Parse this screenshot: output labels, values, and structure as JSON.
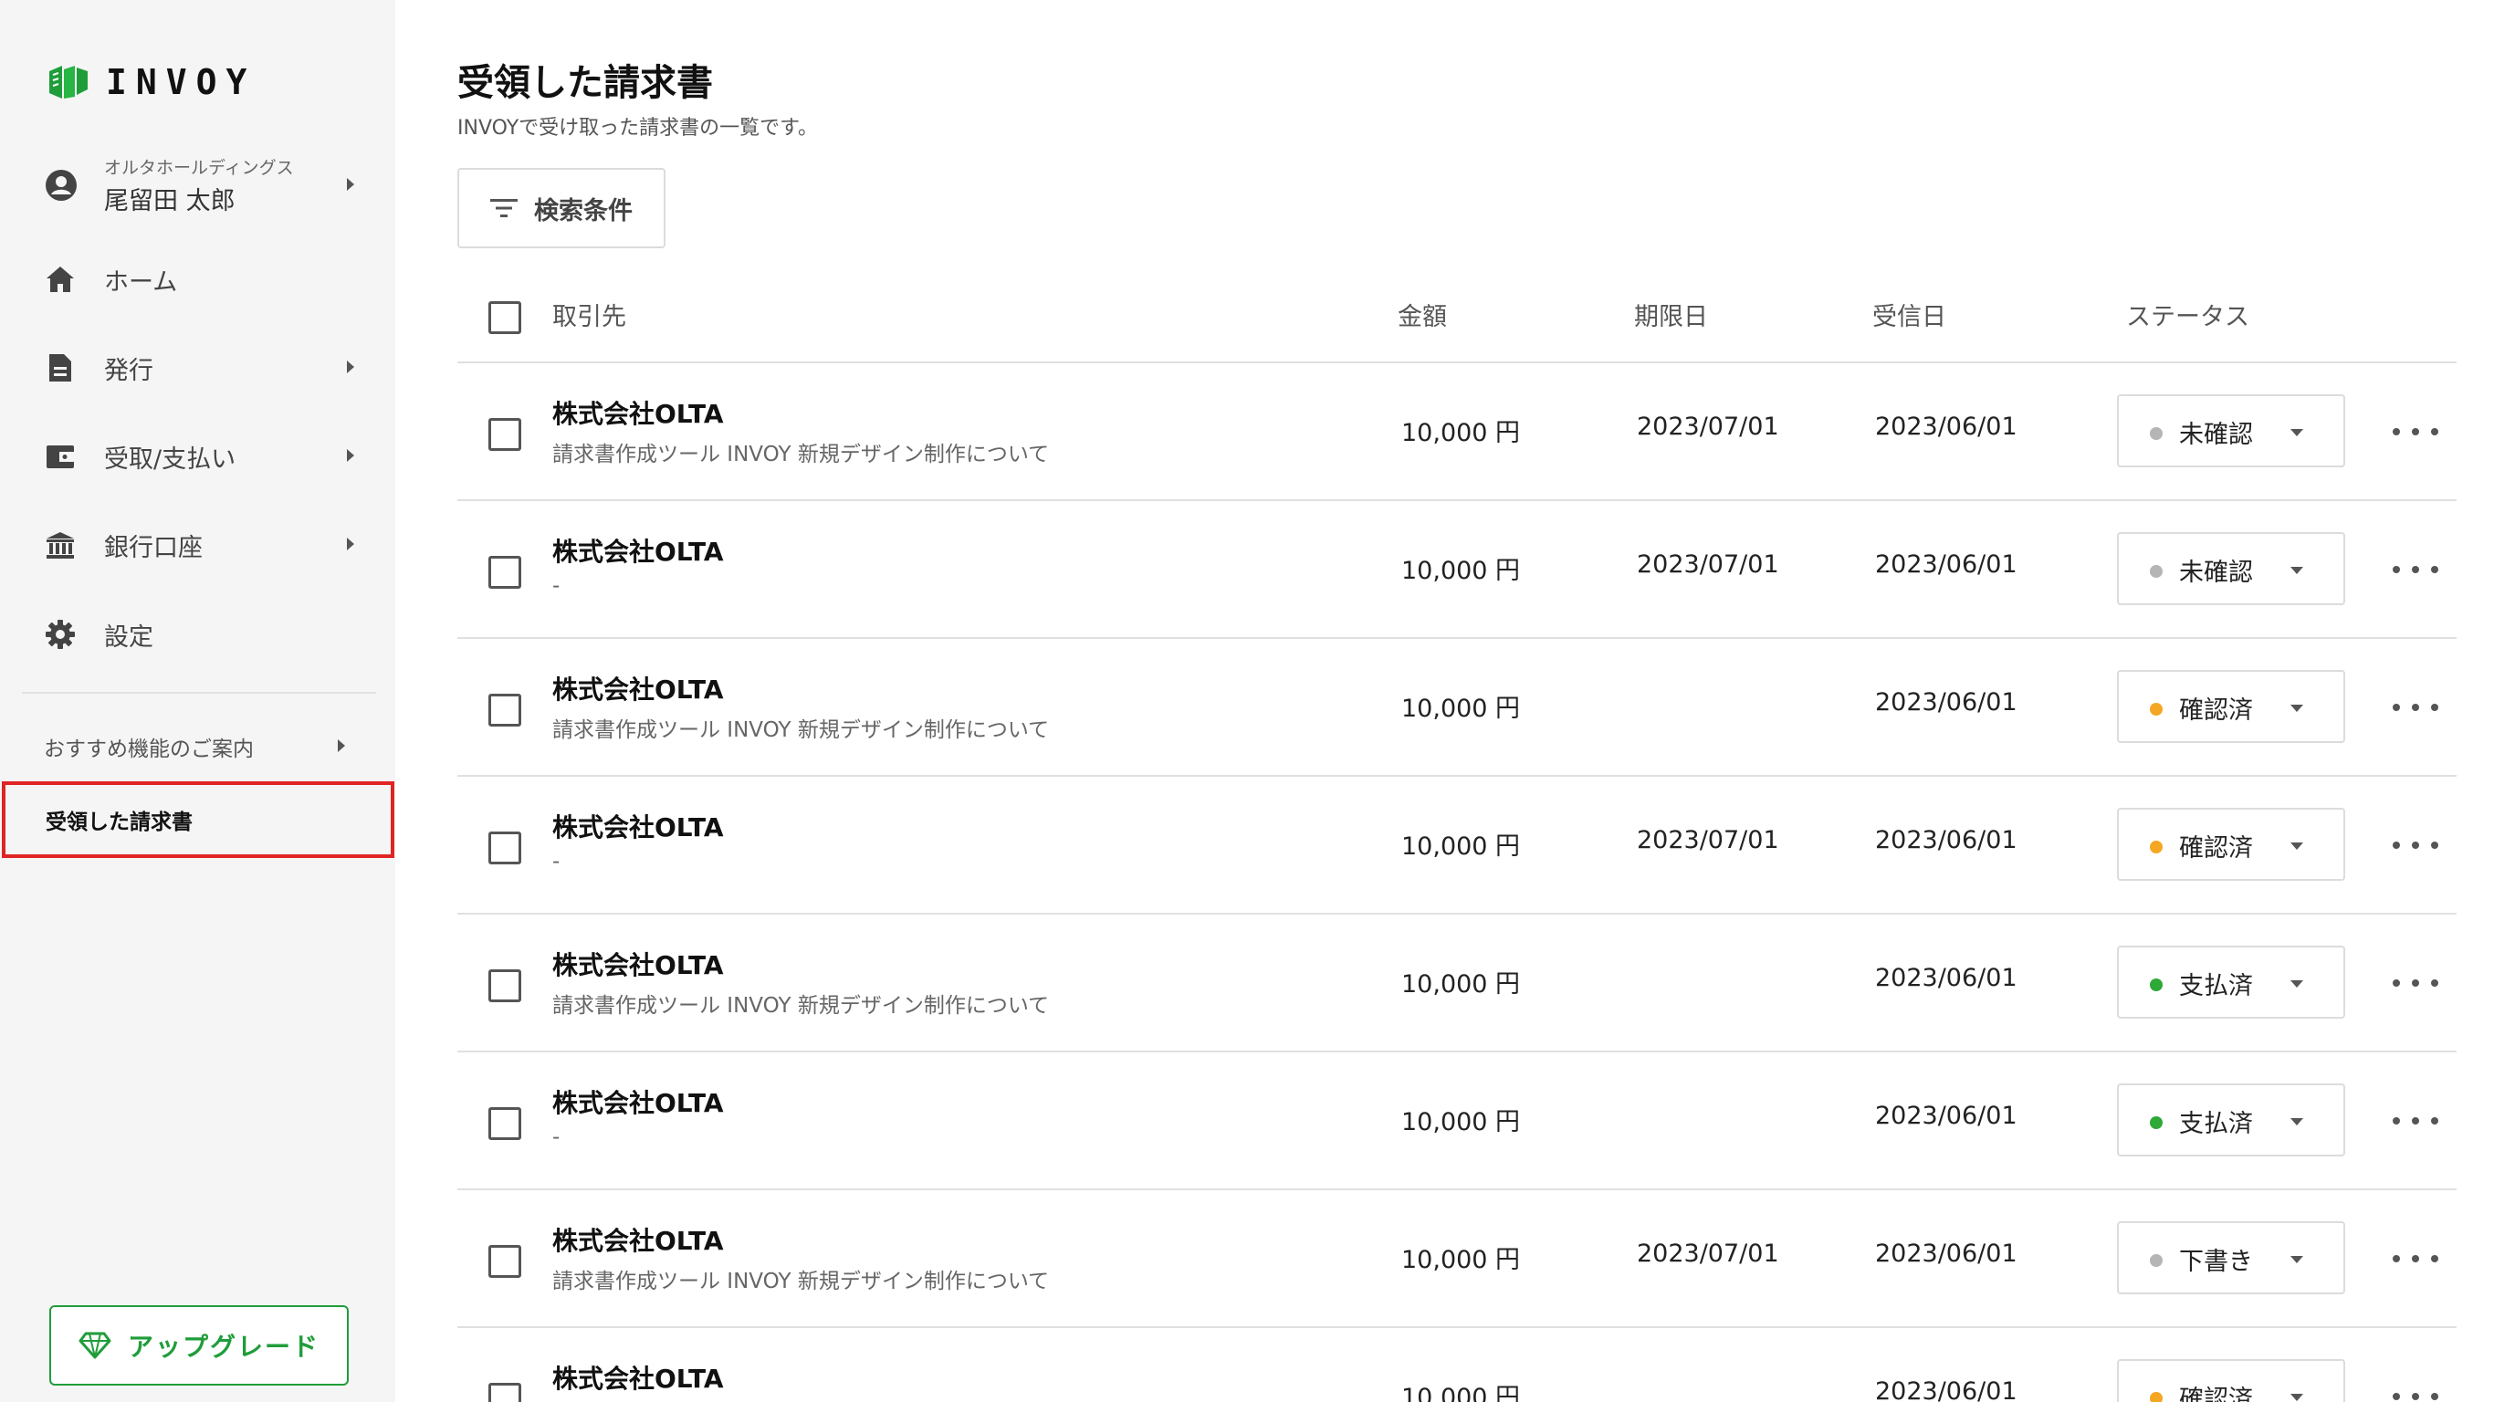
{
  "brand": {
    "name": "INVOY",
    "accent": "#1f9d3a"
  },
  "account": {
    "company": "オルタホールディングス",
    "user": "尾留田 太郎"
  },
  "nav": {
    "home": "ホーム",
    "issue": "発行",
    "receive_pay": "受取/支払い",
    "bank": "銀行口座",
    "settings": "設定",
    "recommend": "おすすめ機能のご案内",
    "received": "受領した請求書"
  },
  "upgrade_label": "アップグレード",
  "page": {
    "title": "受領した請求書",
    "subtitle": "INVOYで受け取った請求書の一覧です。",
    "filter_label": "検索条件"
  },
  "table": {
    "headers": {
      "vendor": "取引先",
      "amount": "金額",
      "due": "期限日",
      "received": "受信日",
      "status": "ステータス"
    },
    "rows": [
      {
        "vendor": "株式会社OLTA",
        "desc": "請求書作成ツール INVOY 新規デザイン制作について",
        "amount": "10,000 円",
        "due": "2023/07/01",
        "received": "2023/06/01",
        "status": "未確認",
        "status_color": "#b5b5b5"
      },
      {
        "vendor": "株式会社OLTA",
        "desc": "-",
        "amount": "10,000 円",
        "due": "2023/07/01",
        "received": "2023/06/01",
        "status": "未確認",
        "status_color": "#b5b5b5"
      },
      {
        "vendor": "株式会社OLTA",
        "desc": "請求書作成ツール INVOY 新規デザイン制作について",
        "amount": "10,000 円",
        "due": "",
        "received": "2023/06/01",
        "status": "確認済",
        "status_color": "#f5a623"
      },
      {
        "vendor": "株式会社OLTA",
        "desc": "-",
        "amount": "10,000 円",
        "due": "2023/07/01",
        "received": "2023/06/01",
        "status": "確認済",
        "status_color": "#f5a623"
      },
      {
        "vendor": "株式会社OLTA",
        "desc": "請求書作成ツール INVOY 新規デザイン制作について",
        "amount": "10,000 円",
        "due": "",
        "received": "2023/06/01",
        "status": "支払済",
        "status_color": "#2ea836"
      },
      {
        "vendor": "株式会社OLTA",
        "desc": "-",
        "amount": "10,000 円",
        "due": "",
        "received": "2023/06/01",
        "status": "支払済",
        "status_color": "#2ea836"
      },
      {
        "vendor": "株式会社OLTA",
        "desc": "請求書作成ツール INVOY 新規デザイン制作について",
        "amount": "10,000 円",
        "due": "2023/07/01",
        "received": "2023/06/01",
        "status": "下書き",
        "status_color": "#b5b5b5"
      },
      {
        "vendor": "株式会社OLTA",
        "desc": "",
        "amount": "10,000 円",
        "due": "",
        "received": "2023/06/01",
        "status": "確認済",
        "status_color": "#f5a623"
      }
    ]
  }
}
